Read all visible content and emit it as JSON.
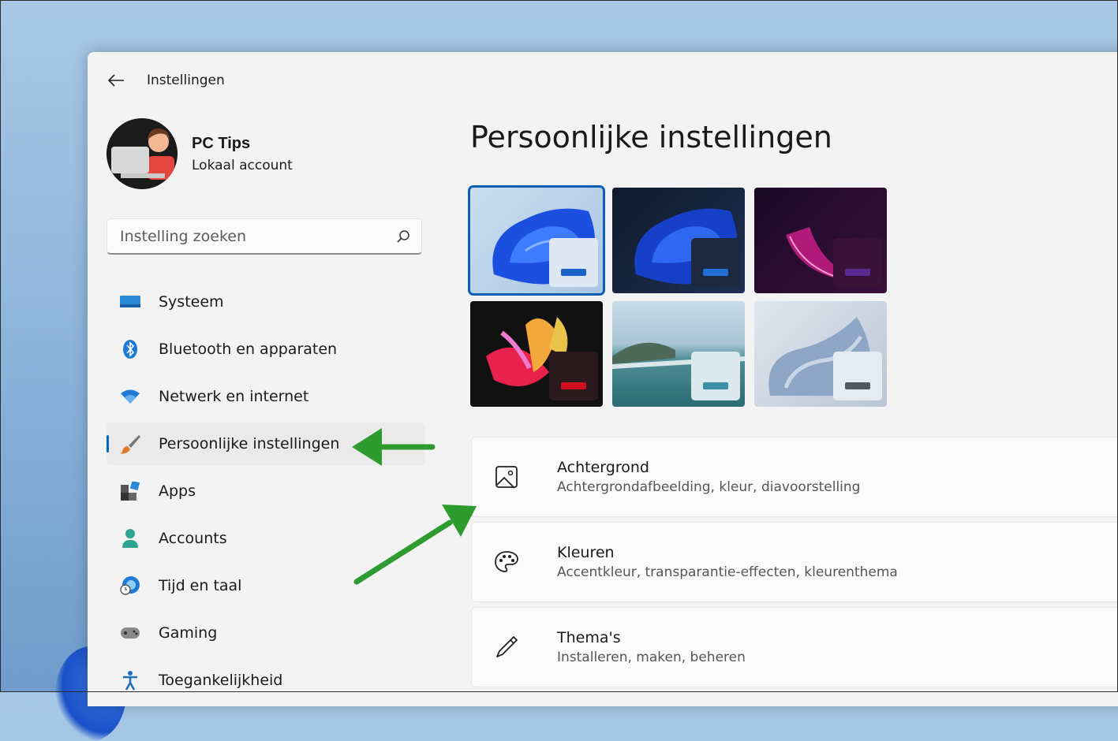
{
  "window": {
    "title": "Instellingen"
  },
  "profile": {
    "name": "PC Tips",
    "account_type": "Lokaal account"
  },
  "search": {
    "placeholder": "Instelling zoeken"
  },
  "sidebar": {
    "items": [
      {
        "label": "Systeem",
        "icon": "display-icon"
      },
      {
        "label": "Bluetooth en apparaten",
        "icon": "bluetooth-icon"
      },
      {
        "label": "Netwerk en internet",
        "icon": "wifi-icon"
      },
      {
        "label": "Persoonlijke instellingen",
        "icon": "brush-icon",
        "active": true
      },
      {
        "label": "Apps",
        "icon": "apps-icon"
      },
      {
        "label": "Accounts",
        "icon": "person-icon"
      },
      {
        "label": "Tijd en taal",
        "icon": "clock-globe-icon"
      },
      {
        "label": "Gaming",
        "icon": "gamepad-icon"
      },
      {
        "label": "Toegankelijkheid",
        "icon": "accessibility-icon"
      }
    ]
  },
  "main": {
    "title": "Persoonlijke instellingen",
    "themes": [
      {
        "name": "light-bloom",
        "selected": true
      },
      {
        "name": "dark-bloom",
        "selected": false
      },
      {
        "name": "glow",
        "selected": false
      },
      {
        "name": "captured-motion",
        "selected": false
      },
      {
        "name": "flow-lake",
        "selected": false
      },
      {
        "name": "sunrise",
        "selected": false
      }
    ],
    "cards": [
      {
        "title": "Achtergrond",
        "subtitle": "Achtergrondafbeelding, kleur, diavoorstelling",
        "icon": "image-icon"
      },
      {
        "title": "Kleuren",
        "subtitle": "Accentkleur, transparantie-effecten, kleurenthema",
        "icon": "palette-icon"
      },
      {
        "title": "Thema's",
        "subtitle": "Installeren, maken, beheren",
        "icon": "pen-icon"
      }
    ]
  },
  "colors": {
    "accent": "#0067c0",
    "annotation_arrow": "#2e9b2e",
    "window_bg": "#f3f3f3"
  }
}
